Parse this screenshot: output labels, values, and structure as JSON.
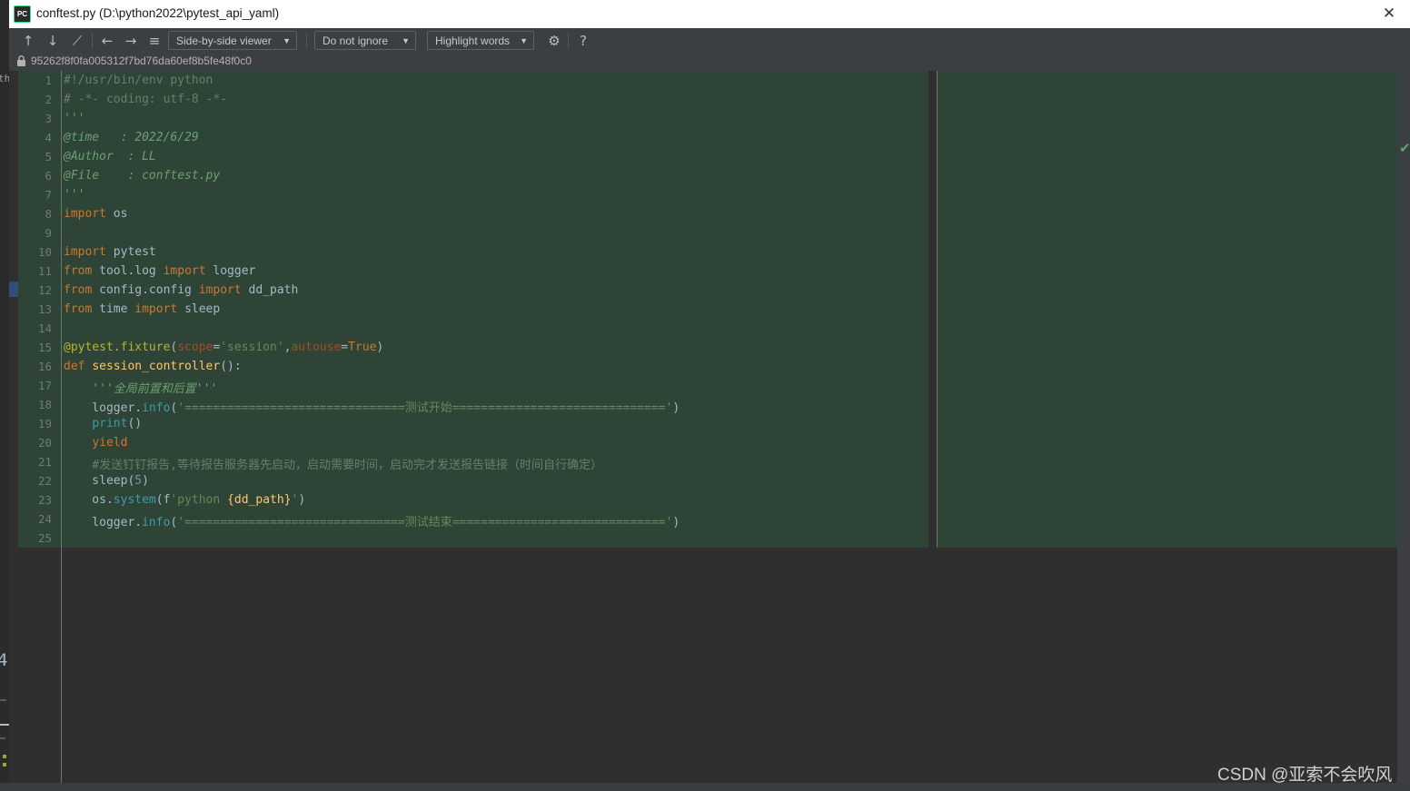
{
  "window": {
    "title": "conftest.py (D:\\python2022\\pytest_api_yaml)",
    "app_icon_label": "PC",
    "close_label": "✕"
  },
  "toolbar": {
    "icons": [
      {
        "name": "previous-difference-icon",
        "glyph": "↑"
      },
      {
        "name": "next-difference-icon",
        "glyph": "↓"
      },
      {
        "name": "edit-icon",
        "glyph": "⟋"
      },
      {
        "name": "back-icon",
        "glyph": "←"
      },
      {
        "name": "forward-icon",
        "glyph": "→"
      },
      {
        "name": "line-status-icon",
        "glyph": "≡"
      }
    ],
    "viewer_mode": "Side-by-side viewer",
    "ignore_mode": "Do not ignore",
    "highlight_mode": "Highlight words",
    "settings_glyph": "⚙",
    "help_glyph": "?",
    "caret": "▼"
  },
  "info_bar": {
    "revision_hash": "95262f8f0fa005312f7bd76da60ef8b5fe48f0c0"
  },
  "editor": {
    "line_numbers": [
      "1",
      "2",
      "3",
      "4",
      "5",
      "6",
      "7",
      "8",
      "9",
      "10",
      "11",
      "12",
      "13",
      "14",
      "15",
      "16",
      "17",
      "18",
      "19",
      "20",
      "21",
      "22",
      "23",
      "24",
      "25"
    ],
    "lines": [
      {
        "n": 1,
        "text": "#!/usr/bin/env python"
      },
      {
        "n": 2,
        "text": "# -*- coding: utf-8 -*-"
      },
      {
        "n": 3,
        "text": "'''"
      },
      {
        "n": 4,
        "text": "@time   : 2022/6/29"
      },
      {
        "n": 5,
        "text": "@Author  : LL"
      },
      {
        "n": 6,
        "text": "@File    : conftest.py"
      },
      {
        "n": 7,
        "text": "'''"
      },
      {
        "n": 8,
        "text": "import os"
      },
      {
        "n": 9,
        "text": ""
      },
      {
        "n": 10,
        "text": "import pytest"
      },
      {
        "n": 11,
        "text": "from tool.log import logger"
      },
      {
        "n": 12,
        "text": "from config.config import dd_path"
      },
      {
        "n": 13,
        "text": "from time import sleep"
      },
      {
        "n": 14,
        "text": ""
      },
      {
        "n": 15,
        "text": "@pytest.fixture(scope='session',autouse=True)"
      },
      {
        "n": 16,
        "text": "def session_controller():"
      },
      {
        "n": 17,
        "text": "    '''全局前置和后置'''"
      },
      {
        "n": 18,
        "text": "    logger.info('===============================测试开始=============================')"
      },
      {
        "n": 19,
        "text": "    print()"
      },
      {
        "n": 20,
        "text": "    yield"
      },
      {
        "n": 21,
        "text": "    #发送钉钉报告,等待报告服务器先启动，启动需要时间，启动完才发送报告链接（时间自行确定）"
      },
      {
        "n": 22,
        "text": "    sleep(5)"
      },
      {
        "n": 23,
        "text": "    os.system(f'python {dd_path}')"
      },
      {
        "n": 24,
        "text": "    logger.info('===============================测试结束=============================')"
      },
      {
        "n": 25,
        "text": ""
      }
    ]
  },
  "status": {
    "inspection_ok_glyph": "✔"
  },
  "watermark": {
    "text": "CSDN @亚索不会吹风"
  },
  "background_window": {
    "left_edge_fragment": "th",
    "line_fragment": "4"
  },
  "colors": {
    "diff_green": "#2d4436",
    "panel_bg": "#3c3f41",
    "editor_bg": "#2f2f2f",
    "accent_check": "#59a869",
    "titlebar_bg": "#ffffff"
  }
}
